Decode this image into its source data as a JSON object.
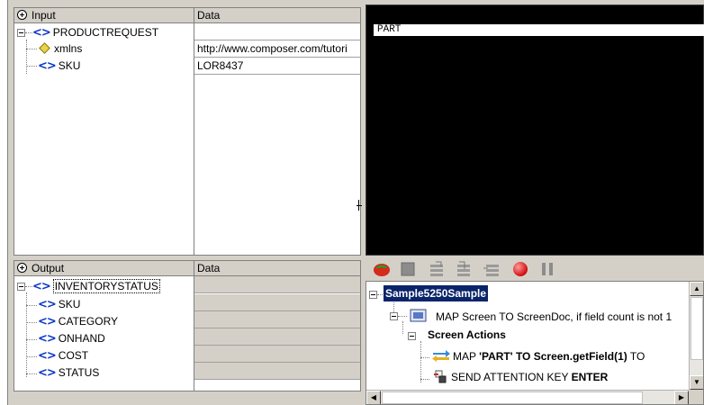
{
  "input_pane": {
    "header": {
      "col1": "Input",
      "col2": "Data"
    },
    "rows": [
      {
        "label": "PRODUCTREQUEST",
        "icon": "element-icon",
        "data": ""
      },
      {
        "label": "xmlns",
        "icon": "attribute-icon",
        "data": "http://www.composer.com/tutori"
      },
      {
        "label": "SKU",
        "icon": "element-icon",
        "data": "LOR8437"
      }
    ]
  },
  "output_pane": {
    "header": {
      "col1": "Output",
      "col2": "Data"
    },
    "rows": [
      {
        "label": "INVENTORYSTATUS",
        "icon": "element-icon",
        "data": ""
      },
      {
        "label": "SKU",
        "icon": "element-icon",
        "data": ""
      },
      {
        "label": "CATEGORY",
        "icon": "element-icon",
        "data": ""
      },
      {
        "label": "ONHAND",
        "icon": "element-icon",
        "data": ""
      },
      {
        "label": "COST",
        "icon": "element-icon",
        "data": ""
      },
      {
        "label": "STATUS",
        "icon": "element-icon",
        "data": ""
      }
    ]
  },
  "element_glyph": "<>",
  "terminal": {
    "field_value": "PART"
  },
  "toolbar": {
    "buttons": [
      "run-icon",
      "stop-icon",
      "step-icon",
      "step-into-icon",
      "step-out-icon",
      "record-icon",
      "pause-icon"
    ]
  },
  "flow": {
    "root": "Sample5250Sample",
    "map_screen": "MAP Screen TO ScreenDoc, if field count is not 1",
    "screen_actions": "Screen Actions",
    "map_part_prefix": "MAP ",
    "map_part_bold": "'PART' TO Screen.getField(1)",
    "map_part_suffix": " TO",
    "send_prefix": "SEND ATTENTION KEY ",
    "send_bold": "ENTER"
  },
  "colors": {
    "panel_gray": "#d4d0c8",
    "element_icon_blue": "#0a35c8",
    "selection_blue": "#0a246a",
    "terminal_black": "#000000"
  }
}
